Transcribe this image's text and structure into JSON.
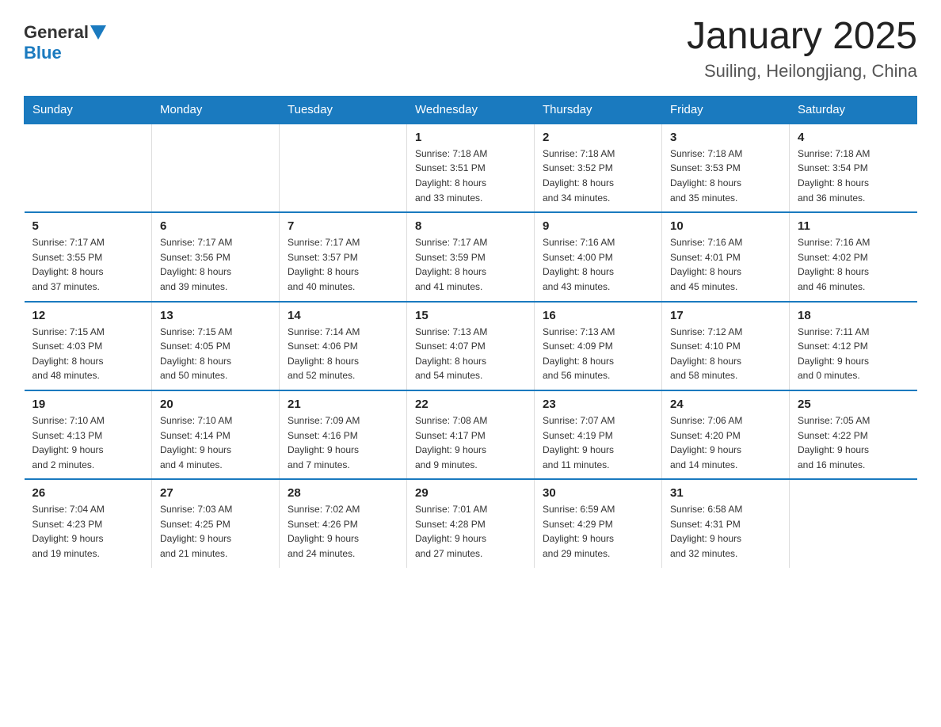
{
  "header": {
    "logo_general": "General",
    "logo_blue": "Blue",
    "title": "January 2025",
    "subtitle": "Suiling, Heilongjiang, China"
  },
  "weekdays": [
    "Sunday",
    "Monday",
    "Tuesday",
    "Wednesday",
    "Thursday",
    "Friday",
    "Saturday"
  ],
  "weeks": [
    [
      {
        "day": "",
        "info": ""
      },
      {
        "day": "",
        "info": ""
      },
      {
        "day": "",
        "info": ""
      },
      {
        "day": "1",
        "info": "Sunrise: 7:18 AM\nSunset: 3:51 PM\nDaylight: 8 hours\nand 33 minutes."
      },
      {
        "day": "2",
        "info": "Sunrise: 7:18 AM\nSunset: 3:52 PM\nDaylight: 8 hours\nand 34 minutes."
      },
      {
        "day": "3",
        "info": "Sunrise: 7:18 AM\nSunset: 3:53 PM\nDaylight: 8 hours\nand 35 minutes."
      },
      {
        "day": "4",
        "info": "Sunrise: 7:18 AM\nSunset: 3:54 PM\nDaylight: 8 hours\nand 36 minutes."
      }
    ],
    [
      {
        "day": "5",
        "info": "Sunrise: 7:17 AM\nSunset: 3:55 PM\nDaylight: 8 hours\nand 37 minutes."
      },
      {
        "day": "6",
        "info": "Sunrise: 7:17 AM\nSunset: 3:56 PM\nDaylight: 8 hours\nand 39 minutes."
      },
      {
        "day": "7",
        "info": "Sunrise: 7:17 AM\nSunset: 3:57 PM\nDaylight: 8 hours\nand 40 minutes."
      },
      {
        "day": "8",
        "info": "Sunrise: 7:17 AM\nSunset: 3:59 PM\nDaylight: 8 hours\nand 41 minutes."
      },
      {
        "day": "9",
        "info": "Sunrise: 7:16 AM\nSunset: 4:00 PM\nDaylight: 8 hours\nand 43 minutes."
      },
      {
        "day": "10",
        "info": "Sunrise: 7:16 AM\nSunset: 4:01 PM\nDaylight: 8 hours\nand 45 minutes."
      },
      {
        "day": "11",
        "info": "Sunrise: 7:16 AM\nSunset: 4:02 PM\nDaylight: 8 hours\nand 46 minutes."
      }
    ],
    [
      {
        "day": "12",
        "info": "Sunrise: 7:15 AM\nSunset: 4:03 PM\nDaylight: 8 hours\nand 48 minutes."
      },
      {
        "day": "13",
        "info": "Sunrise: 7:15 AM\nSunset: 4:05 PM\nDaylight: 8 hours\nand 50 minutes."
      },
      {
        "day": "14",
        "info": "Sunrise: 7:14 AM\nSunset: 4:06 PM\nDaylight: 8 hours\nand 52 minutes."
      },
      {
        "day": "15",
        "info": "Sunrise: 7:13 AM\nSunset: 4:07 PM\nDaylight: 8 hours\nand 54 minutes."
      },
      {
        "day": "16",
        "info": "Sunrise: 7:13 AM\nSunset: 4:09 PM\nDaylight: 8 hours\nand 56 minutes."
      },
      {
        "day": "17",
        "info": "Sunrise: 7:12 AM\nSunset: 4:10 PM\nDaylight: 8 hours\nand 58 minutes."
      },
      {
        "day": "18",
        "info": "Sunrise: 7:11 AM\nSunset: 4:12 PM\nDaylight: 9 hours\nand 0 minutes."
      }
    ],
    [
      {
        "day": "19",
        "info": "Sunrise: 7:10 AM\nSunset: 4:13 PM\nDaylight: 9 hours\nand 2 minutes."
      },
      {
        "day": "20",
        "info": "Sunrise: 7:10 AM\nSunset: 4:14 PM\nDaylight: 9 hours\nand 4 minutes."
      },
      {
        "day": "21",
        "info": "Sunrise: 7:09 AM\nSunset: 4:16 PM\nDaylight: 9 hours\nand 7 minutes."
      },
      {
        "day": "22",
        "info": "Sunrise: 7:08 AM\nSunset: 4:17 PM\nDaylight: 9 hours\nand 9 minutes."
      },
      {
        "day": "23",
        "info": "Sunrise: 7:07 AM\nSunset: 4:19 PM\nDaylight: 9 hours\nand 11 minutes."
      },
      {
        "day": "24",
        "info": "Sunrise: 7:06 AM\nSunset: 4:20 PM\nDaylight: 9 hours\nand 14 minutes."
      },
      {
        "day": "25",
        "info": "Sunrise: 7:05 AM\nSunset: 4:22 PM\nDaylight: 9 hours\nand 16 minutes."
      }
    ],
    [
      {
        "day": "26",
        "info": "Sunrise: 7:04 AM\nSunset: 4:23 PM\nDaylight: 9 hours\nand 19 minutes."
      },
      {
        "day": "27",
        "info": "Sunrise: 7:03 AM\nSunset: 4:25 PM\nDaylight: 9 hours\nand 21 minutes."
      },
      {
        "day": "28",
        "info": "Sunrise: 7:02 AM\nSunset: 4:26 PM\nDaylight: 9 hours\nand 24 minutes."
      },
      {
        "day": "29",
        "info": "Sunrise: 7:01 AM\nSunset: 4:28 PM\nDaylight: 9 hours\nand 27 minutes."
      },
      {
        "day": "30",
        "info": "Sunrise: 6:59 AM\nSunset: 4:29 PM\nDaylight: 9 hours\nand 29 minutes."
      },
      {
        "day": "31",
        "info": "Sunrise: 6:58 AM\nSunset: 4:31 PM\nDaylight: 9 hours\nand 32 minutes."
      },
      {
        "day": "",
        "info": ""
      }
    ]
  ]
}
